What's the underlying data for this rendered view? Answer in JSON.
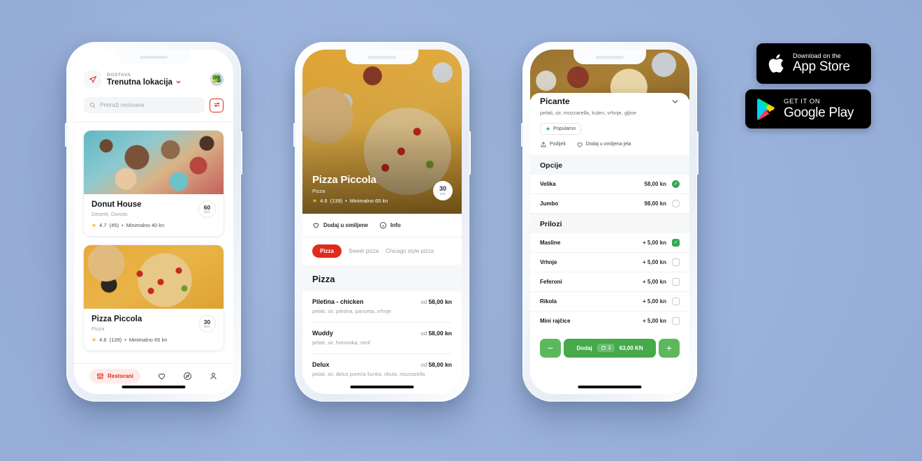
{
  "background_color": "#9db4dc",
  "accent_red": "#df2a1d",
  "accent_green": "#34a853",
  "phone1": {
    "header": {
      "delivery_label": "DOSTAVA",
      "location": "Trenutna lokacija",
      "chevron_icon": "chevron-down-icon",
      "nav_icon": "navigation-arrow-icon",
      "avatar_icon": "user-avatar"
    },
    "search": {
      "placeholder": "Pretraži restorane",
      "search_icon": "search-icon",
      "filter_icon": "filter-sliders-icon"
    },
    "restaurants": [
      {
        "name": "Donut House",
        "categories": "Deserti, Donuts",
        "rating": "4.7",
        "reviews": "(45)",
        "minimum": "Minimalno 40 kn",
        "time_value": "60",
        "time_unit": "MIN",
        "separator": "•"
      },
      {
        "name": "Pizza Piccola",
        "categories": "Pizza",
        "rating": "4.6",
        "reviews": "(139)",
        "minimum": "Minimalno 65 kn",
        "time_value": "30",
        "time_unit": "MIN",
        "separator": "•"
      }
    ],
    "tabs": [
      {
        "label": "Restorani",
        "icon": "storefront-icon",
        "active": true
      },
      {
        "label": "",
        "icon": "heart-icon",
        "active": false
      },
      {
        "label": "",
        "icon": "compass-icon",
        "active": false
      },
      {
        "label": "",
        "icon": "person-icon",
        "active": false
      }
    ]
  },
  "phone2": {
    "hero": {
      "name": "Pizza Piccola",
      "category": "Pizza",
      "rating": "4.6",
      "reviews": "(139)",
      "separator": "•",
      "minimum": "Minimalno 65 kn",
      "time_value": "30",
      "time_unit": "MIN"
    },
    "actions": [
      {
        "label": "Dodaj u omiljene",
        "icon": "heart-icon"
      },
      {
        "label": "Info",
        "icon": "info-icon"
      }
    ],
    "chips": [
      {
        "label": "Pizza",
        "active": true
      },
      {
        "label": "Sweet pizza",
        "active": false
      },
      {
        "label": "Chicago style pizza",
        "active": false
      }
    ],
    "menu_section": "Pizza",
    "menu_items": [
      {
        "name": "Piletina - chicken",
        "price_prefix": "od",
        "price": "58,00 kn",
        "desc": "pelati, sir, piletina, panceta, vrhnje"
      },
      {
        "name": "Wuddy",
        "price_prefix": "od",
        "price": "58,00 kn",
        "desc": "pelati, sir, hrenovka, senf"
      },
      {
        "name": "Delux",
        "price_prefix": "od",
        "price": "58,00 kn",
        "desc": "pelati, sir, delux pureća šunka, rikula, mozzarella"
      }
    ]
  },
  "phone3": {
    "product": {
      "title": "Picante",
      "description": "pelati, sir, mozzarella, kulen, vrhnje, gljive",
      "collapse_icon": "chevron-down-icon",
      "badge": "Popularno",
      "badge_icon": "star-icon"
    },
    "actions": [
      {
        "label": "Podijeli",
        "icon": "share-icon"
      },
      {
        "label": "Dodaj u omiljena jela",
        "icon": "heart-icon"
      }
    ],
    "options_section": "Opcije",
    "options": [
      {
        "name": "Velika",
        "price": "58,00 kn",
        "selected": true
      },
      {
        "name": "Jumbo",
        "price": "98,00 kn",
        "selected": false
      }
    ],
    "extras_section": "Prilozi",
    "extras": [
      {
        "name": "Masline",
        "price": "+ 5,00 kn",
        "selected": true
      },
      {
        "name": "Vrhnje",
        "price": "+ 5,00 kn",
        "selected": false
      },
      {
        "name": "Feferoni",
        "price": "+ 5,00 kn",
        "selected": false
      },
      {
        "name": "Rikola",
        "price": "+ 5,00 kn",
        "selected": false
      },
      {
        "name": "Mini rajčice",
        "price": "+ 5,00 kn",
        "selected": false
      }
    ],
    "cart": {
      "decrement": "−",
      "increment": "+",
      "add_label": "Dodaj",
      "quantity": "1",
      "total": "63,00 KN",
      "cart_icon": "shopping-basket-icon"
    }
  },
  "badges": {
    "app_store": {
      "small": "Download on the",
      "big": "App Store",
      "icon": "apple-logo-icon"
    },
    "google_play": {
      "small": "GET IT ON",
      "big": "Google Play",
      "icon": "google-play-triangle-icon"
    }
  }
}
